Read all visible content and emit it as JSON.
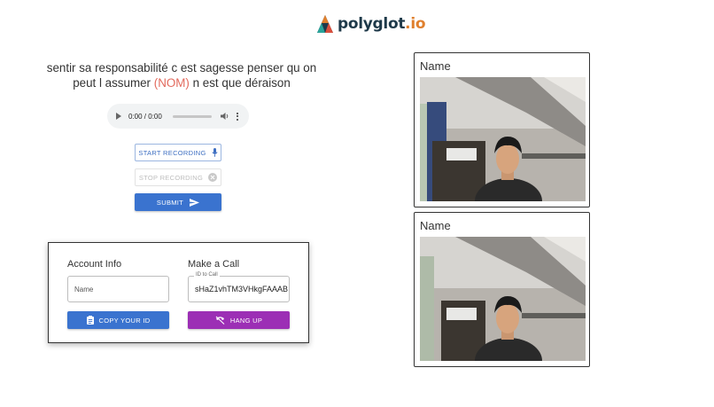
{
  "header": {
    "brand": "polyglot",
    "brand_suffix": ".io"
  },
  "prompt": {
    "text_before": "sentir sa responsabilité c est sagesse penser qu on peut l assumer ",
    "highlight": "(NOM)",
    "text_after": " n est que déraison",
    "highlight_color": "#e26a5d"
  },
  "audio": {
    "time": "0:00 / 0:00"
  },
  "recording": {
    "start_label": "START RECORDING",
    "stop_label": "STOP RECORDING",
    "submit_label": "SUBMIT"
  },
  "account": {
    "title": "Account Info",
    "name_placeholder": "Name",
    "copy_label": "COPY YOUR ID"
  },
  "call": {
    "title": "Make a Call",
    "id_label": "ID to Call",
    "id_value": "sHaZ1vhTM3VHkgFAAAB",
    "hangup_label": "HANG UP"
  },
  "videos": [
    {
      "name": "Name"
    },
    {
      "name": "Name"
    }
  ],
  "colors": {
    "primary": "#3a73cf",
    "hangup": "#9c2fb5",
    "brand_dark": "#1f3a4a",
    "brand_accent": "#e0802e"
  },
  "icons": {
    "start": "mic-icon",
    "stop": "cancel-circle-icon",
    "submit": "send-icon",
    "copy": "clipboard-icon",
    "hangup": "phone-hangup-icon"
  }
}
